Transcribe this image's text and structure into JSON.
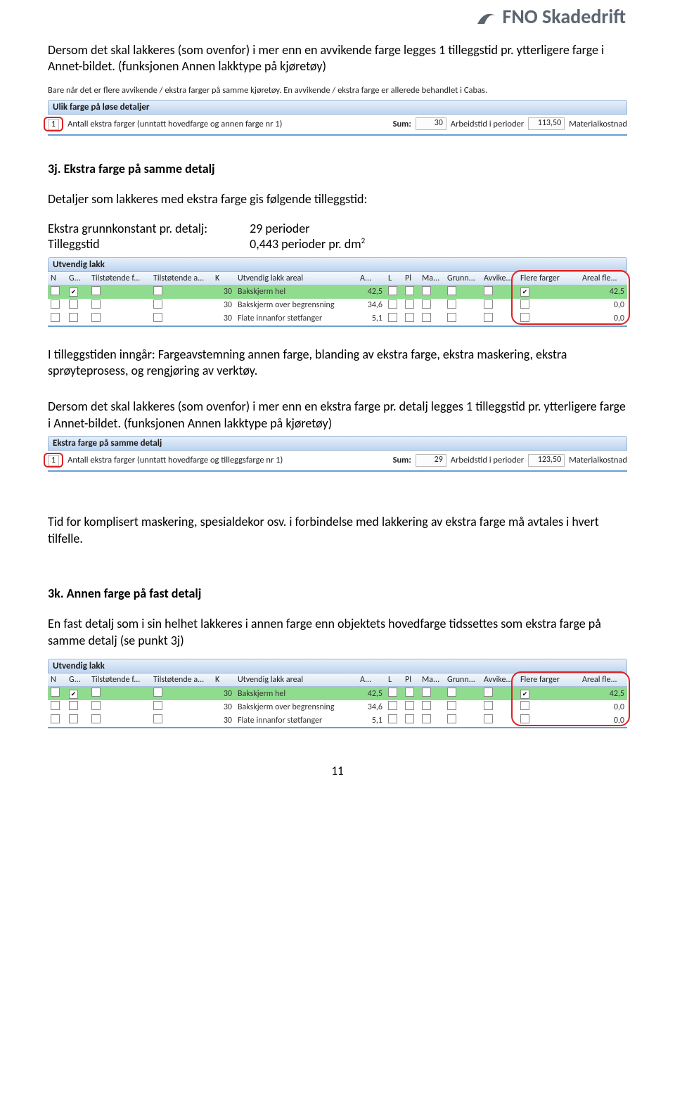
{
  "logo": {
    "text": "FNO Skadedrift"
  },
  "para1": "Dersom det skal lakkeres (som ovenfor) i mer enn en avvikende farge legges 1 tilleggstid pr. ytterligere farge i Annet-bildet. (funksjonen Annen lakktype på kjøretøy)",
  "intro1": "Bare når det er flere avvikende / ekstra farger på samme kjøretøy. En avvikende / ekstra farge er allerede behandlet i Cabas.",
  "panel1": {
    "title": "Ulik farge på løse detaljer",
    "count": "1",
    "label": "Antall ekstra farger (unntatt hovedfarge og annen farge nr 1)",
    "sumLabel": "Sum:",
    "sum": "30",
    "arbLabel": "Arbeidstid i perioder",
    "arb": "113,50",
    "matLabel": "Materialkostnad"
  },
  "head_3j": "3j. Ekstra farge på samme detalj",
  "para3j_intro": "Detaljer som lakkeres med ekstra farge gis følgende tilleggstid:",
  "spec": {
    "r1a": "Ekstra grunnkonstant pr. detalj:",
    "r1b": "29 perioder",
    "r2a": "Tilleggstid",
    "r2b": "0,443 perioder pr. dm"
  },
  "utv": {
    "title": "Utvendig lakk",
    "headers": [
      "N",
      "G...",
      "Tilstøtende f...",
      "Tilstøtende a...",
      "K",
      "Utvendig lakk areal",
      "A...",
      "L",
      "Pl",
      "Ma...",
      "Grunn...",
      "Avvike...",
      "Flere farger",
      "Areal fle..."
    ],
    "rows": [
      {
        "gchk": true,
        "k": "30",
        "name": "Bakskjerm hel",
        "a": "42,5",
        "flere": true,
        "fa": "42,5",
        "hl": true
      },
      {
        "gchk": false,
        "k": "30",
        "name": "Bakskjerm over begrensning",
        "a": "34,6",
        "flere": false,
        "fa": "0,0",
        "hl": false
      },
      {
        "gchk": false,
        "k": "30",
        "name": "Flate innanfor støtfanger",
        "a": "5,1",
        "flere": false,
        "fa": "0,0",
        "hl": false
      }
    ]
  },
  "para_after_tbl": "I tilleggstiden inngår: Fargeavstemning annen farge, blanding av ekstra farge, ekstra maskering, ekstra sprøyteprosess, og rengjøring av verktøy.",
  "para_dersom2": "Dersom det skal lakkeres (som ovenfor) i mer enn en ekstra farge pr. detalj legges 1 tilleggstid pr. ytterligere farge i Annet-bildet. (funksjonen Annen lakktype på kjøretøy)",
  "panel2": {
    "title": "Ekstra farge på samme detalj",
    "count": "1",
    "label": "Antall ekstra farger (unntatt hovedfarge og tilleggsfarge nr 1)",
    "sumLabel": "Sum:",
    "sum": "29",
    "arbLabel": "Arbeidstid i perioder",
    "arb": "123,50",
    "matLabel": "Materialkostnad"
  },
  "para_tid": "Tid for komplisert maskering, spesialdekor osv. i forbindelse med lakkering av ekstra farge må avtales i hvert tilfelle.",
  "head_3k": "3k. Annen farge på fast detalj",
  "para3k": "En fast detalj som i sin helhet lakkeres i annen farge enn objektets hovedfarge tidssettes som ekstra farge på samme detalj (se punkt 3j)",
  "pagenum": "11"
}
